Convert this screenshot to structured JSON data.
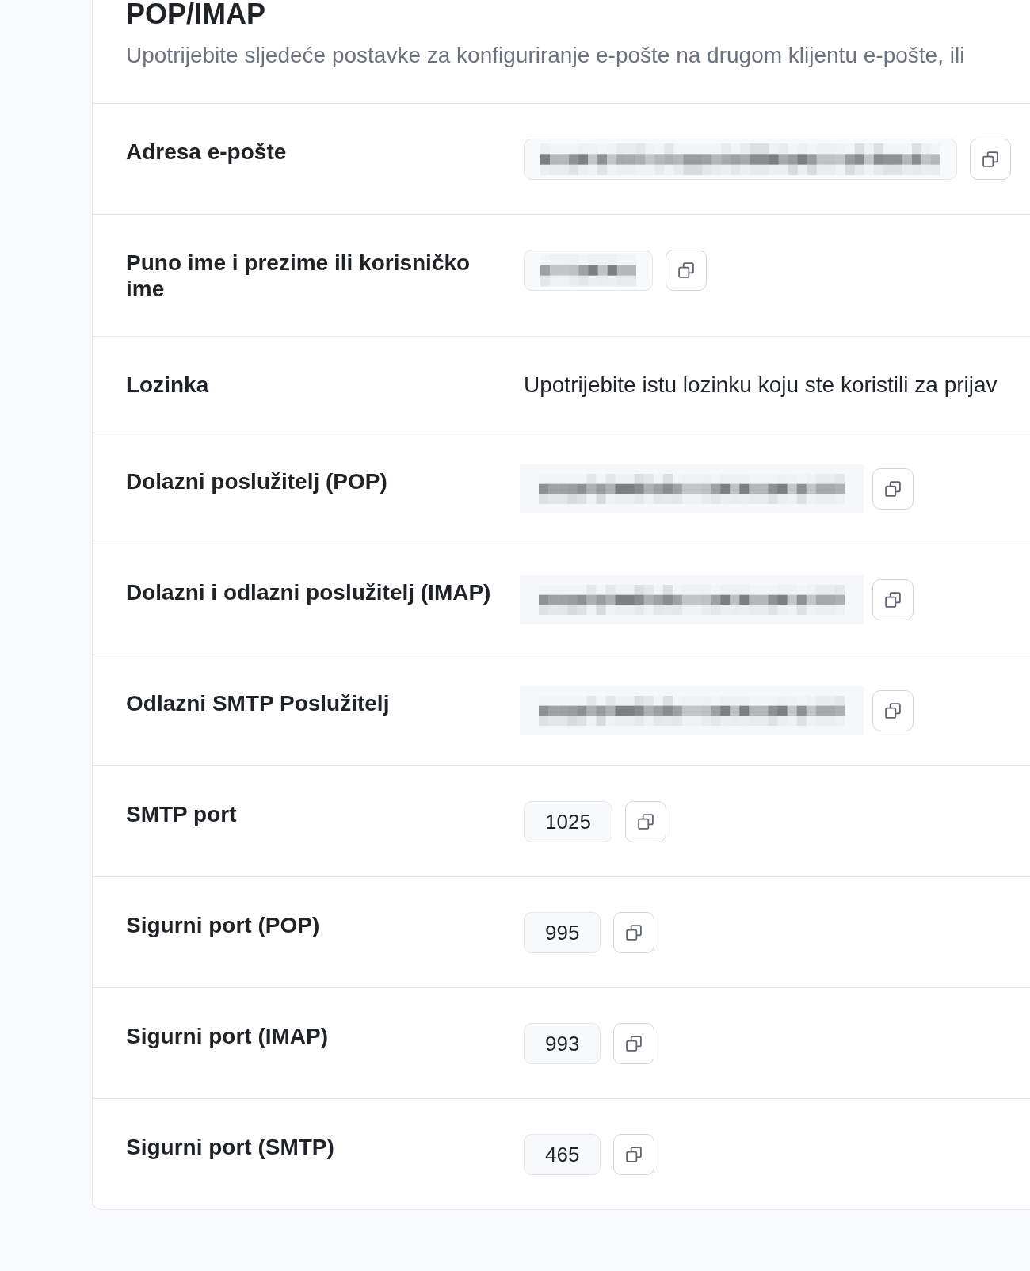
{
  "section": {
    "title": "POP/IMAP",
    "description": "Upotrijebite sljedeće postavke za konfiguriranje e-pošte na drugom klijentu e-pošte, ili"
  },
  "rows": [
    {
      "label": "Adresa e-pošte",
      "kind": "masked"
    },
    {
      "label": "Puno ime i prezime ili korisničko ime",
      "kind": "masked"
    },
    {
      "label": "Lozinka",
      "kind": "note",
      "text": "Upotrijebite istu lozinku koju ste koristili za prijav"
    },
    {
      "label": "Dolazni poslužitelj (POP)",
      "kind": "blurred"
    },
    {
      "label": "Dolazni i odlazni poslužitelj (IMAP)",
      "kind": "blurred"
    },
    {
      "label": "Odlazni SMTP Poslužitelj",
      "kind": "blurred"
    },
    {
      "label": "SMTP port",
      "kind": "field",
      "value": "1025"
    },
    {
      "label": "Sigurni port (POP)",
      "kind": "field",
      "value": "995"
    },
    {
      "label": "Sigurni port (IMAP)",
      "kind": "field",
      "value": "993"
    },
    {
      "label": "Sigurni port (SMTP)",
      "kind": "field",
      "value": "465"
    }
  ]
}
